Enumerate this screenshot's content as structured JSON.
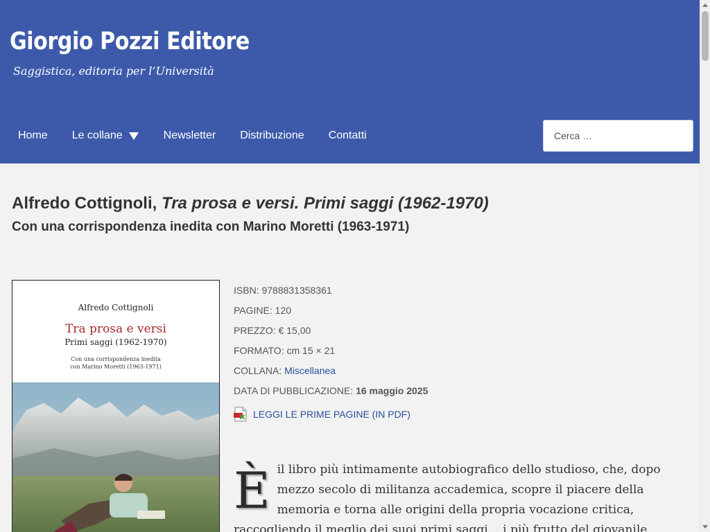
{
  "header": {
    "site_title": "Giorgio Pozzi Editore",
    "tagline": "Saggistica, editoria per l’Università",
    "bg_color": "#3d5aaa"
  },
  "nav": {
    "items": [
      {
        "label": "Home"
      },
      {
        "label": "Le collane",
        "has_dropdown": true
      },
      {
        "label": "Newsletter"
      },
      {
        "label": "Distribuzione"
      },
      {
        "label": "Contatti"
      }
    ]
  },
  "search": {
    "placeholder": "Cerca …"
  },
  "book": {
    "author": "Alfredo Cottignoli,",
    "title": "Tra prosa e versi. Primi saggi (1962-1970)",
    "subtitle": "Con una corrispondenza inedita con Marino Moretti (1963-1971)"
  },
  "cover": {
    "author": "Alfredo Cottignoli",
    "title": "Tra prosa e versi",
    "subtitle": "Primi saggi (1962-1970)",
    "note_line1": "Con una corrispondenza inedita",
    "note_line2": "con Marino Moretti (1963-1971)"
  },
  "meta": {
    "isbn_label": "ISBN:",
    "isbn": "9788831358361",
    "pages_label": "PAGINE:",
    "pages": "120",
    "price_label": "PREZZO:",
    "price": "€ 15,00",
    "format_label": "FORMATO:",
    "format": "cm 15 × 21",
    "series_label": "COLLANA:",
    "series": "Miscellanea",
    "date_label": "DATA DI PUBBLICAZIONE:",
    "date": "16 maggio 2025",
    "pdf_link": "LEGGI LE PRIME PAGINE (IN PDF)"
  },
  "description": {
    "dropcap": "È",
    "text": "il libro più intimamente autobiografico dello studioso, che, dopo mezzo secolo di militanza accademica, scopre il piacere della memoria e torna alle origini della propria vocazione critica, raccogliendo il meglio dei suoi primi saggi... i più frutto del giovanile"
  }
}
